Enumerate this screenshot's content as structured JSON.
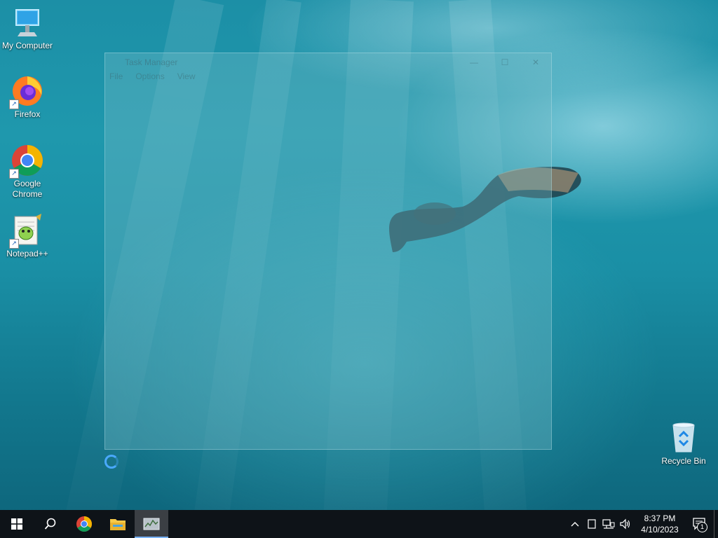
{
  "desktop": {
    "icons": [
      {
        "label": "My Computer",
        "icon": "computer-icon"
      },
      {
        "label": "Firefox",
        "icon": "firefox-icon"
      },
      {
        "label": "Google Chrome",
        "icon": "chrome-icon"
      },
      {
        "label": "Notepad++",
        "icon": "notepadpp-icon"
      },
      {
        "label": "Recycle Bin",
        "icon": "recycle-bin-icon"
      }
    ],
    "shortcut_arrow": "↗"
  },
  "task_manager": {
    "title": "Task Manager",
    "menu": [
      "File",
      "Options",
      "View"
    ],
    "controls": {
      "minimize": "—",
      "maximize": "☐",
      "close": "✕"
    }
  },
  "taskbar": {
    "buttons": [
      {
        "name": "start",
        "icon": "windows-logo-icon"
      },
      {
        "name": "search",
        "icon": "search-icon"
      },
      {
        "name": "chrome",
        "icon": "chrome-icon"
      },
      {
        "name": "file-explorer",
        "icon": "folder-icon"
      },
      {
        "name": "task-manager",
        "icon": "task-manager-icon",
        "active": true
      }
    ],
    "tray": {
      "chevron": "^",
      "time": "8:37 PM",
      "date": "4/10/2023",
      "notification_count": "1"
    }
  },
  "colors": {
    "taskbar": "#0e1318",
    "accent": "#7ab4ff",
    "spinner": "#4aa9ff"
  }
}
